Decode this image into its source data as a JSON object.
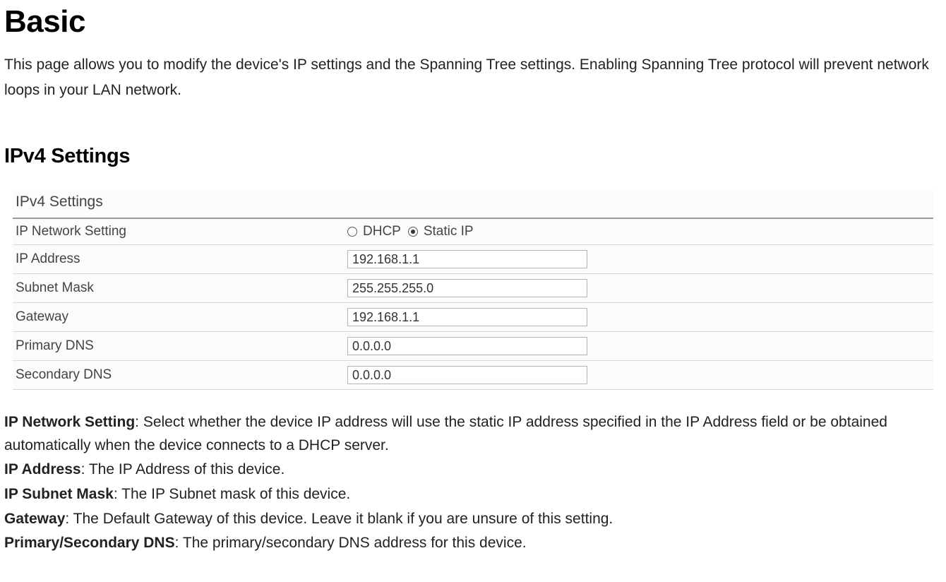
{
  "title": "Basic",
  "intro": "This page allows you to modify the device's IP settings and the Spanning Tree settings. Enabling Spanning Tree protocol will prevent network loops in your LAN network.",
  "section_heading": "IPv4 Settings",
  "panel": {
    "header": "IPv4 Settings",
    "network_setting": {
      "label": "IP Network Setting",
      "options": {
        "dhcp": "DHCP",
        "static": "Static IP"
      },
      "selected": "static"
    },
    "rows": {
      "ip_address": {
        "label": "IP Address",
        "value": "192.168.1.1"
      },
      "subnet_mask": {
        "label": "Subnet Mask",
        "value": "255.255.255.0"
      },
      "gateway": {
        "label": "Gateway",
        "value": "192.168.1.1"
      },
      "primary_dns": {
        "label": "Primary DNS",
        "value": "0.0.0.0"
      },
      "secondary_dns": {
        "label": "Secondary DNS",
        "value": "0.0.0.0"
      }
    }
  },
  "descriptions": {
    "ip_network_setting": {
      "term": "IP Network Setting",
      "text": ": Select whether the device IP address will use the static IP address specified in the IP Address field or be obtained automatically when the device connects to a DHCP server."
    },
    "ip_address": {
      "term": "IP Address",
      "text": ": The IP Address of this device."
    },
    "subnet_mask": {
      "term": "IP Subnet Mask",
      "text": ": The IP Subnet mask of this device."
    },
    "gateway": {
      "term": "Gateway",
      "text": ": The Default Gateway of this device. Leave it blank if you are unsure of this setting."
    },
    "dns": {
      "term": "Primary/Secondary DNS",
      "text": ": The primary/secondary DNS address for this device."
    }
  }
}
